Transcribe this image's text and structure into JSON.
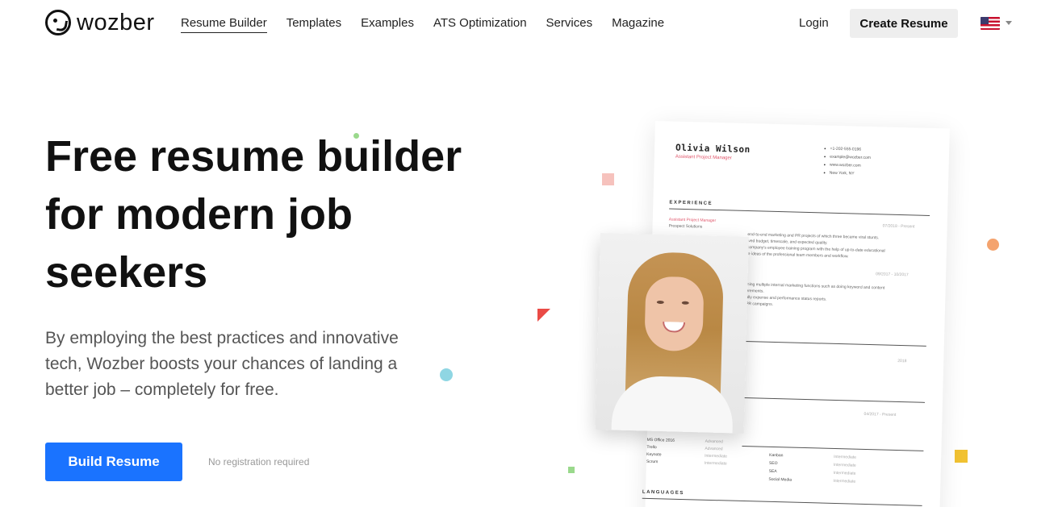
{
  "header": {
    "logo_text": "wozber",
    "nav": [
      "Resume Builder",
      "Templates",
      "Examples",
      "ATS Optimization",
      "Services",
      "Magazine"
    ],
    "login_label": "Login",
    "create_label": "Create Resume"
  },
  "hero": {
    "headline": "Free resume builder for modern job seekers",
    "subtext": "By employing the best practices and innovative tech, Wozber boosts your chances of landing a better job – completely for free.",
    "button_label": "Build Resume",
    "note": "No registration required"
  },
  "resume": {
    "name": "Olivia Wilson",
    "title": "Assistant Project Manager",
    "contact": [
      "+1-202-555-0196",
      "example@wozber.com",
      "www.wozber.com",
      "New York, NY"
    ],
    "section_experience": "EXPERIENCE",
    "job_title": "Assistant Project Manager",
    "job_company": "Prospect Solutions",
    "job_date": "07/2018 - Present",
    "bullets": [
      "end-to-end marketing and PR projects of which three became viral stunts.",
      "ived budget, timescale, and expected quality.",
      "company's employee training program with the help of up-to-date educational",
      "ie ideas of the professional team members and workflow."
    ],
    "date_2": "09/2017 - 10/2017",
    "bullets_2": [
      "ining multiple internal marketing functions such as doing keyword and content",
      "erements.",
      "ully expense and performance status reports.",
      "PR campaigns."
    ],
    "date_3": "2018",
    "date_4": "04/2017 - Present",
    "skills_left": [
      "MS Office 2016",
      "Trello",
      "Keynote",
      "Scrum"
    ],
    "levels_left": [
      "Advanced",
      "Advanced",
      "Intermediate",
      "Intermediate"
    ],
    "skills_right": [
      "Kanban",
      "SEO",
      "SEA",
      "Social Media"
    ],
    "levels_right": [
      "Intermediate",
      "Intermediate",
      "Intermediate",
      "Intermediate"
    ],
    "section_languages": "LANGUAGES"
  },
  "colors": {
    "primary": "#1a73ff",
    "accent_pink": "#e0566b"
  }
}
